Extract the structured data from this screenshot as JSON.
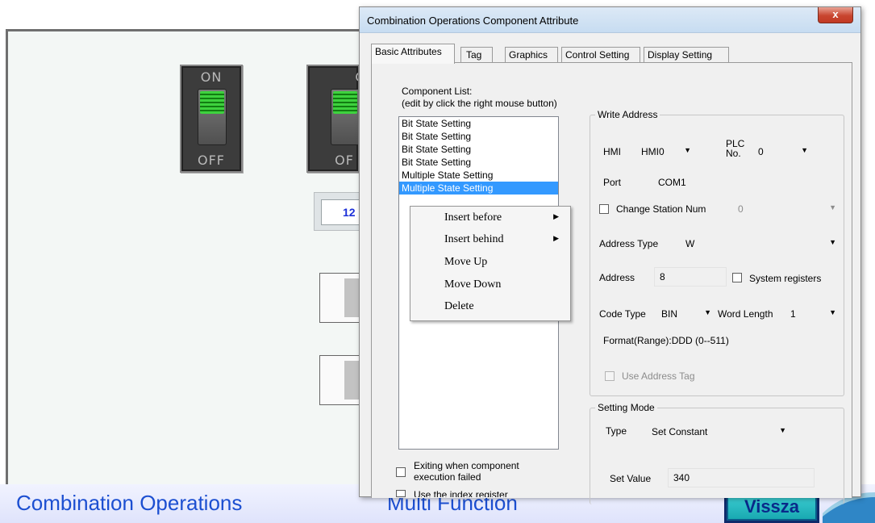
{
  "canvas": {
    "toggles": [
      {
        "on_label": "ON",
        "off_label": "OFF"
      },
      {
        "on_label": "O",
        "off_label": "OF"
      }
    ],
    "display_value": "12"
  },
  "banner": {
    "left_title": "Combination Operations",
    "mid_title": "Multi Function",
    "back_button": "Vissza"
  },
  "dialog": {
    "title": "Combination Operations Component Attribute",
    "close_label": "x",
    "tabs": [
      "Basic Attributes",
      "Tag",
      "Graphics",
      "Control Setting",
      "Display Setting"
    ],
    "component_list_label": "Component List:",
    "component_list_hint": "(edit by click the right mouse button)",
    "components": [
      "Bit State Setting",
      "Bit State Setting",
      "Bit State Setting",
      "Bit State Setting",
      "Multiple State Setting",
      "Multiple State Setting"
    ],
    "context_menu": [
      {
        "label": "Insert before",
        "submenu": true
      },
      {
        "label": "Insert behind",
        "submenu": true
      },
      {
        "label": "Move Up",
        "submenu": false
      },
      {
        "label": "Move Down",
        "submenu": false
      },
      {
        "label": "Delete",
        "submenu": false
      }
    ],
    "exit_on_fail_label": "Exiting when component execution failed",
    "index_register_label": "Use the index register",
    "write_address": {
      "legend": "Write Address",
      "hmi_label": "HMI",
      "hmi_value": "HMI0",
      "plc_label": "PLC No.",
      "plc_value": "0",
      "port_label": "Port",
      "port_value": "COM1",
      "change_station_label": "Change Station Num",
      "change_station_value": "0",
      "address_type_label": "Address Type",
      "address_type_value": "W",
      "address_label": "Address",
      "address_value": "8",
      "system_registers_label": "System registers",
      "code_type_label": "Code Type",
      "code_type_value": "BIN",
      "word_length_label": "Word Length",
      "word_length_value": "1",
      "format_text": "Format(Range):DDD (0--511)",
      "use_address_tag_label": "Use Address Tag"
    },
    "setting_mode": {
      "legend": "Setting Mode",
      "type_label": "Type",
      "type_value": "Set Constant",
      "set_value_label": "Set Value",
      "set_value": "340"
    }
  }
}
